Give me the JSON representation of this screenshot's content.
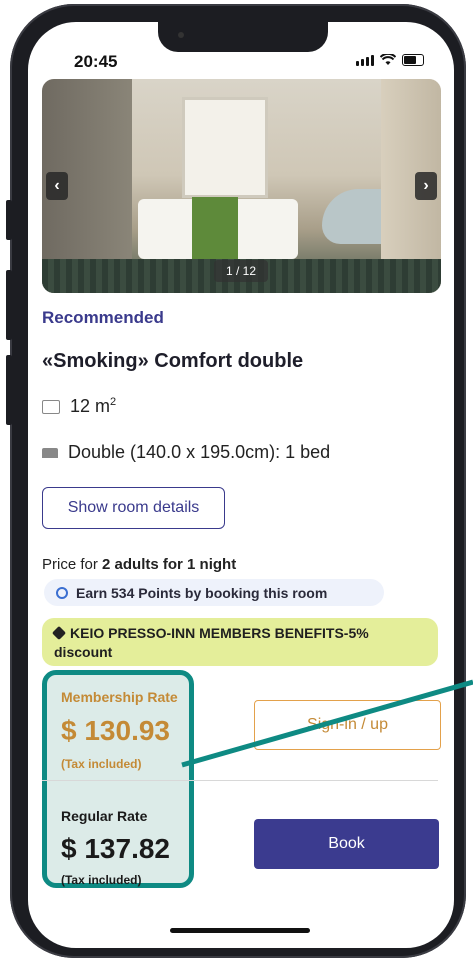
{
  "status_bar": {
    "time": "20:45"
  },
  "gallery": {
    "counter": "1 / 12",
    "prev_icon": "chevron-left-icon",
    "next_icon": "chevron-right-icon"
  },
  "room": {
    "tag": "Recommended",
    "name": "«Smoking» Comfort double",
    "size_text": "12 m",
    "size_sup": "2",
    "bed_text": "Double (140.0 x 195.0cm): 1 bed",
    "details_button": "Show room details"
  },
  "pricing": {
    "price_for_prefix": "Price for ",
    "price_for_bold": "2 adults for 1 night",
    "points_text": "Earn 534 Points by booking this room",
    "benefit_text": "KEIO PRESSO-INN MEMBERS BENEFITS-5% discount",
    "membership_label": "Membership Rate",
    "membership_price": "$ 130.93",
    "membership_tax": "(Tax included)",
    "regular_label": "Regular Rate",
    "regular_price": "$ 137.82",
    "regular_tax": "(Tax included)",
    "signin_button": "Sign-in / up",
    "book_button": "Book"
  },
  "colors": {
    "accent": "#3b3b8f",
    "membership": "#c48a36",
    "highlight_border": "#0e8a83",
    "benefit_bg": "#e4ee9a"
  }
}
